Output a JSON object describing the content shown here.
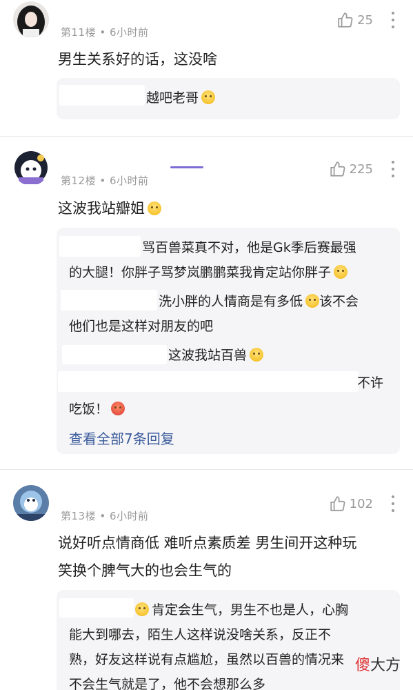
{
  "comments": [
    {
      "floor": "第11楼",
      "time": "6小时前",
      "likes": "25",
      "text": "男生关系好的话，这没啥",
      "avatar_icon": "user-avatar-girl",
      "replies": [
        {
          "text": "越吧老哥"
        }
      ]
    },
    {
      "floor": "第12楼",
      "time": "6小时前",
      "likes": "225",
      "text": "这波我站瓣姐",
      "avatar_icon": "user-avatar-cartoon-cat",
      "replies": [
        {
          "text_l1": "骂百兽菜真不对，他是Gk季后赛最强",
          "text_l2": "的大腿！你胖子骂梦岚鹏鹏菜我肯定站你胖子"
        },
        {
          "text_l1": "洗小胖的人情商是有多低",
          "text_after": "该不会",
          "text_l2": "他们也是这样对朋友的吧"
        },
        {
          "text": "这波我站百兽"
        },
        {
          "text_l1": "不许",
          "text_l2": "吃饭！"
        }
      ],
      "view_all": "查看全部7条回复"
    },
    {
      "floor": "第13楼",
      "time": "6小时前",
      "likes": "102",
      "text_l1": "说好听点情商低 难听点素质差 男生间开这种玩",
      "text_l2": "笑换个脾气大的也会生气的",
      "avatar_icon": "user-avatar-blue-cartoon",
      "replies": [
        {
          "text_l1": "肯定会生气，男生不也是人，心胸",
          "text_l2": "能大到哪去，陌生人这样说没啥关系，反正不",
          "text_l3": "熟，好友这样说有点尴尬，虽然以百兽的情况来",
          "text_l4": "不会生气就是了，他不会想那么多"
        }
      ]
    }
  ],
  "watermark": {
    "part1": "傻",
    "part2": "大方"
  }
}
